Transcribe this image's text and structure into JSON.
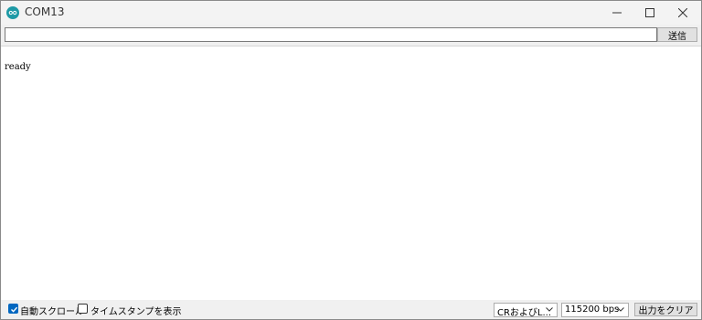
{
  "window": {
    "title": "COM13"
  },
  "send": {
    "input_value": "",
    "button_label": "送信"
  },
  "output": {
    "text": "ready"
  },
  "statusbar": {
    "autoscroll": {
      "label": "自動スクロール",
      "checked": true
    },
    "timestamp": {
      "label": "タイムスタンプを表示",
      "checked": false
    },
    "line_ending": "CRおよびL...",
    "baud_rate": "115200 bps",
    "clear_label": "出力をクリア"
  },
  "colors": {
    "accent": "#0067c0",
    "app_icon": "#1e9aa6"
  },
  "icons": [
    "arduino-icon",
    "minimize-icon",
    "maximize-icon",
    "close-icon",
    "checkmark-icon",
    "chevron-down-icon"
  ]
}
